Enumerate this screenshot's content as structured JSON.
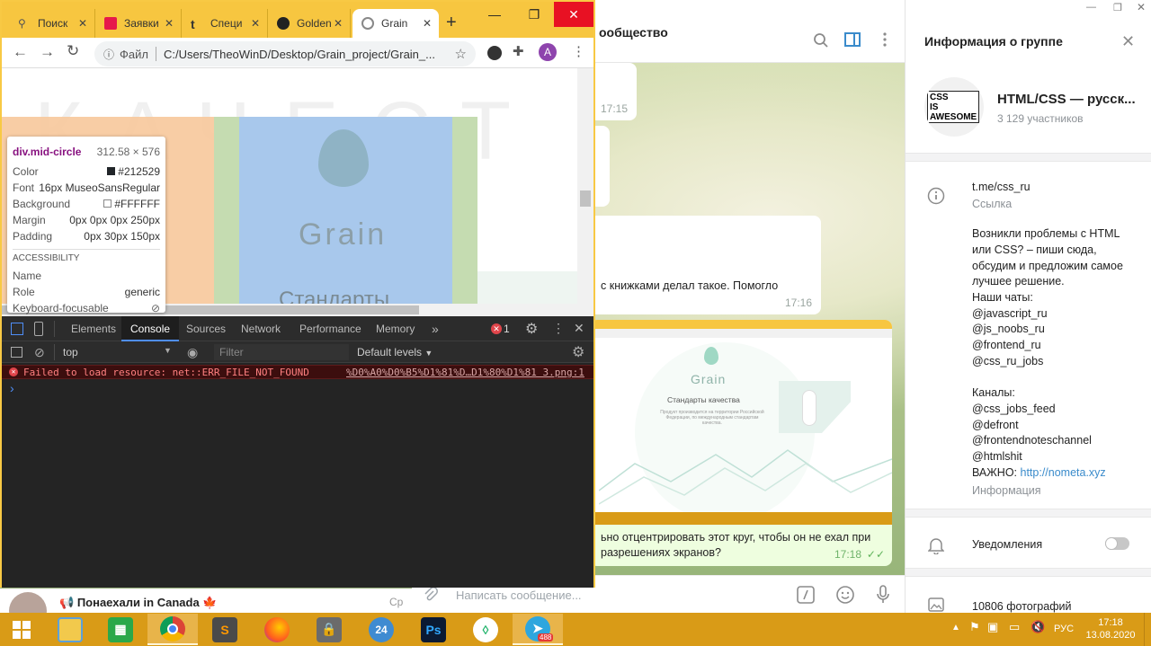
{
  "telegram": {
    "chat_title": "ообщество",
    "input_placeholder": "Написать сообщение...",
    "left_chat": {
      "name": "Понаехали in Canada",
      "time": "Ср"
    },
    "messages": [
      {
        "time": "17:15"
      },
      {
        "text": "с книжками делал такое. Помогло",
        "time": "17:16"
      },
      {
        "text_line1": "ьно отцентрировать этот круг, чтобы он не ехал при",
        "text_line2": "разрешениях экранов?",
        "time": "17:18"
      }
    ],
    "screenshot_preview": {
      "brand": "Grain",
      "heading": "Стандарты качества",
      "desc": "Продукт производится на территории Российской Федерации, по международным стандартам качества."
    }
  },
  "info": {
    "title": "Информация о группе",
    "avatar_text": [
      "CSS",
      "IS",
      "AWESOME"
    ],
    "group_name": "HTML/CSS — русск...",
    "members": "3 129 участников",
    "link": "t.me/css_ru",
    "link_label": "Ссылка",
    "description": [
      "Возникли проблемы с HTML",
      "или CSS? – пиши сюда,",
      "обсудим и предложим самое",
      "лучшее решение."
    ],
    "chats_label": "Наши чаты:",
    "chats": [
      "@javascript_ru",
      "@js_noobs_ru",
      "@frontend_ru",
      "@css_ru_jobs"
    ],
    "channels_label": "Каналы:",
    "channels": [
      "@css_jobs_feed",
      "@defront",
      "@frontendnoteschannel",
      "@htmlshit"
    ],
    "important_prefix": "ВАЖНО: ",
    "important_link": "http://nometa.xyz",
    "info_label": "Информация",
    "notifications": "Уведомления",
    "photos": "10806 фотографий"
  },
  "chrome": {
    "tabs": [
      {
        "label": "Поиск",
        "color": "#ffffff"
      },
      {
        "label": "Заявки",
        "color": "#e6194b"
      },
      {
        "label": "Специ",
        "color": "#222222"
      },
      {
        "label": "Golden",
        "color": "#222222"
      },
      {
        "label": "Grain",
        "color": "#888888"
      }
    ],
    "omnibox_prefix": "Файл",
    "url": "C:/Users/TheoWinD/Desktop/Grain_project/Grain_...",
    "profile_letter": "A",
    "page": {
      "watermark": "КАЧЕСТ",
      "brand": "Grain",
      "heading": "Стандарты"
    },
    "tooltip": {
      "selector": "div.mid-circle",
      "size": "312.58 × 576",
      "rows": [
        {
          "k": "Color",
          "v": "#212529"
        },
        {
          "k": "Font",
          "v": "16px MuseoSansRegular"
        },
        {
          "k": "Background",
          "v": "#FFFFFF"
        },
        {
          "k": "Margin",
          "v": "0px 0px 0px 250px"
        },
        {
          "k": "Padding",
          "v": "0px 30px 150px"
        }
      ],
      "accessibility_label": "ACCESSIBILITY",
      "acc_rows": [
        {
          "k": "Name",
          "v": ""
        },
        {
          "k": "Role",
          "v": "generic"
        },
        {
          "k": "Keyboard-focusable",
          "v": ""
        }
      ]
    }
  },
  "devtools": {
    "tabs": [
      "Elements",
      "Console",
      "Sources",
      "Network",
      "Performance",
      "Memory"
    ],
    "more": "»",
    "error_count": "1",
    "context": "top",
    "filter_placeholder": "Filter",
    "levels": "Default levels",
    "error_text": "Failed to load resource: net::ERR_FILE_NOT_FOUND",
    "error_source": "%D0%A0%D0%B5%D1%81%D…D1%80%D1%81 3.png:1",
    "prompt": "›"
  },
  "taskbar": {
    "lang": "РУС",
    "time": "17:18",
    "date": "13.08.2020",
    "telegram_badge": "488",
    "apps": [
      "start-button",
      "file-explorer",
      "store",
      "chrome",
      "sublime",
      "firefox",
      "app-lock",
      "app-24",
      "photoshop",
      "app-drop",
      "telegram"
    ]
  }
}
